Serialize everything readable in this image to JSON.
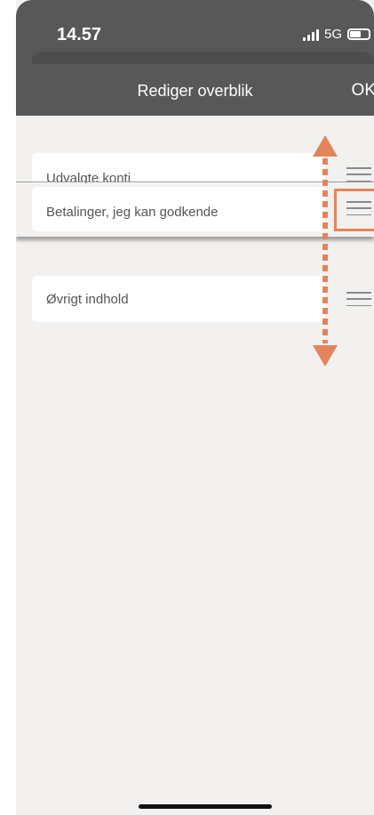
{
  "status_bar": {
    "time": "14.57",
    "network": "5G"
  },
  "header": {
    "title": "Rediger overblik",
    "ok_label": "OK"
  },
  "rows": [
    {
      "label": "Udvalgte konti"
    },
    {
      "label": "Betalinger, jeg kan godkende"
    },
    {
      "label": "Øvrigt indhold"
    }
  ],
  "colors": {
    "header_bg": "#595858",
    "screen_bg": "#f2f1ef",
    "accent": "#e3855b"
  },
  "icons": {
    "reorder": "hamburger-icon",
    "drag_arrows": "double-arrow-vertical-icon"
  }
}
